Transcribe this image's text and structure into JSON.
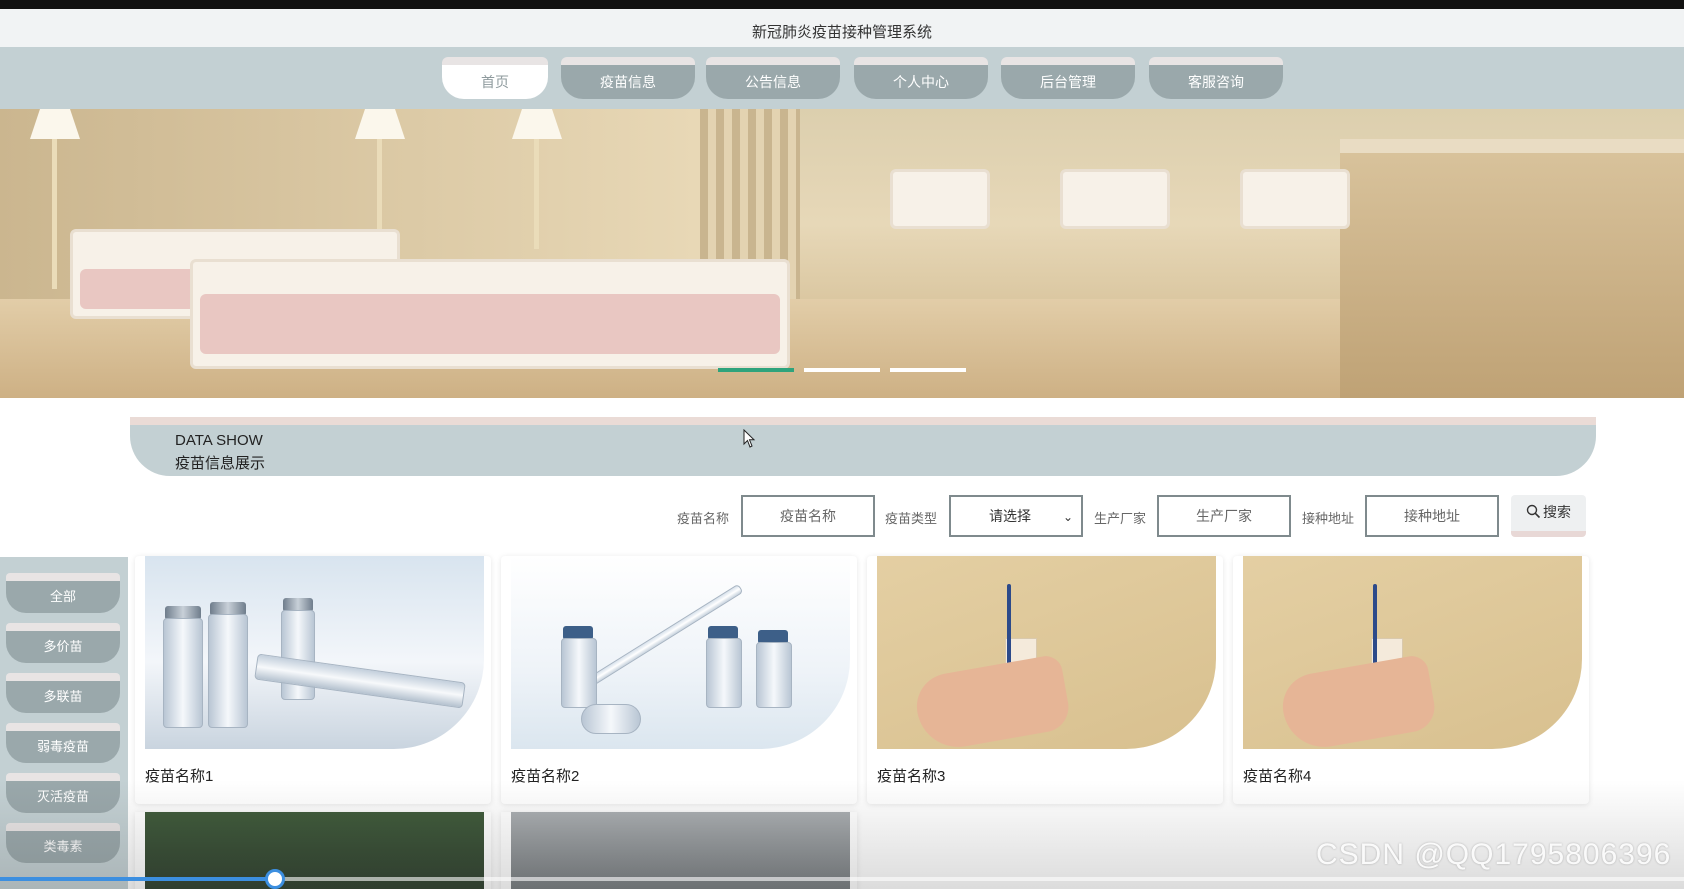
{
  "site": {
    "title": "新冠肺炎疫苗接种管理系统"
  },
  "nav": {
    "items": [
      {
        "label": "首页",
        "active": true
      },
      {
        "label": "疫苗信息",
        "active": false
      },
      {
        "label": "公告信息",
        "active": false
      },
      {
        "label": "个人中心",
        "active": false
      },
      {
        "label": "后台管理",
        "active": false
      },
      {
        "label": "客服咨询",
        "active": false
      }
    ]
  },
  "banner": {
    "slide_count": 3,
    "active_slide": 1
  },
  "section": {
    "title_en": "DATA SHOW",
    "title_cn": "疫苗信息展示"
  },
  "search": {
    "name_label": "疫苗名称",
    "name_placeholder": "疫苗名称",
    "type_label": "疫苗类型",
    "type_selected": "请选择",
    "maker_label": "生产厂家",
    "maker_placeholder": "生产厂家",
    "address_label": "接种地址",
    "address_placeholder": "接种地址",
    "button_label": "搜索"
  },
  "categories": [
    "全部",
    "多价苗",
    "多联苗",
    "弱毒疫苗",
    "灭活疫苗",
    "类毒素"
  ],
  "vaccines": [
    {
      "name": "疫苗名称1"
    },
    {
      "name": "疫苗名称2"
    },
    {
      "name": "疫苗名称3"
    },
    {
      "name": "疫苗名称4"
    }
  ],
  "watermark": "CSDN @QQ1795806396",
  "colors": {
    "accent_green": "#2ea37c",
    "nav_bg": "#c3d0d3",
    "tab_bg": "#9aa8ab",
    "player_blue": "#3c8fe0"
  },
  "video_progress": 0.163
}
